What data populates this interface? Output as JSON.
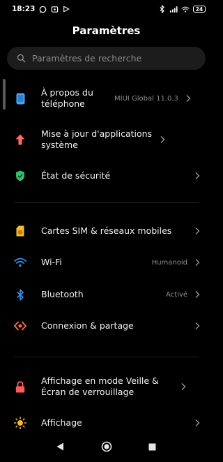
{
  "status_bar": {
    "time": "18:23",
    "battery": "24",
    "icons": [
      "whatsapp-icon",
      "notification-icon",
      "play-icon",
      "bluetooth-icon",
      "signal-icon",
      "wifi-icon"
    ]
  },
  "header": {
    "title": "Paramètres"
  },
  "search": {
    "placeholder": "Paramètres de recherche",
    "icon": "search-icon"
  },
  "rows": [
    {
      "label": "À propos du téléphone",
      "value": "MIUI Global 11.0.3",
      "icon": "phone-icon",
      "color": "#4aa3f0"
    },
    {
      "label": "Mise à jour d'applications système",
      "value": "",
      "icon": "arrow-up-icon",
      "color": "#ff6b5e"
    },
    {
      "label": "État de sécurité",
      "value": "",
      "icon": "shield-icon",
      "color": "#2fbf71"
    },
    {
      "label": "Cartes SIM & réseaux mobiles",
      "value": "",
      "icon": "sim-card-icon",
      "color": "#f5b82e"
    },
    {
      "label": "Wi-Fi",
      "value": "Humanoid",
      "icon": "wifi-icon",
      "color": "#3a8df0"
    },
    {
      "label": "Bluetooth",
      "value": "Activé",
      "icon": "bluetooth-icon",
      "color": "#3a8df0"
    },
    {
      "label": "Connexion & partage",
      "value": "",
      "icon": "share-icon",
      "color": "#ff6b4a"
    },
    {
      "label": "Affichage en mode Veille & Écran de verrouillage",
      "value": "",
      "icon": "lock-icon",
      "color": "#ff5a5a"
    },
    {
      "label": "Affichage",
      "value": "",
      "icon": "sun-icon",
      "color": "#f5b82e"
    }
  ],
  "nav_bar": {
    "buttons": [
      "back-icon",
      "home-icon",
      "recents-icon"
    ]
  }
}
